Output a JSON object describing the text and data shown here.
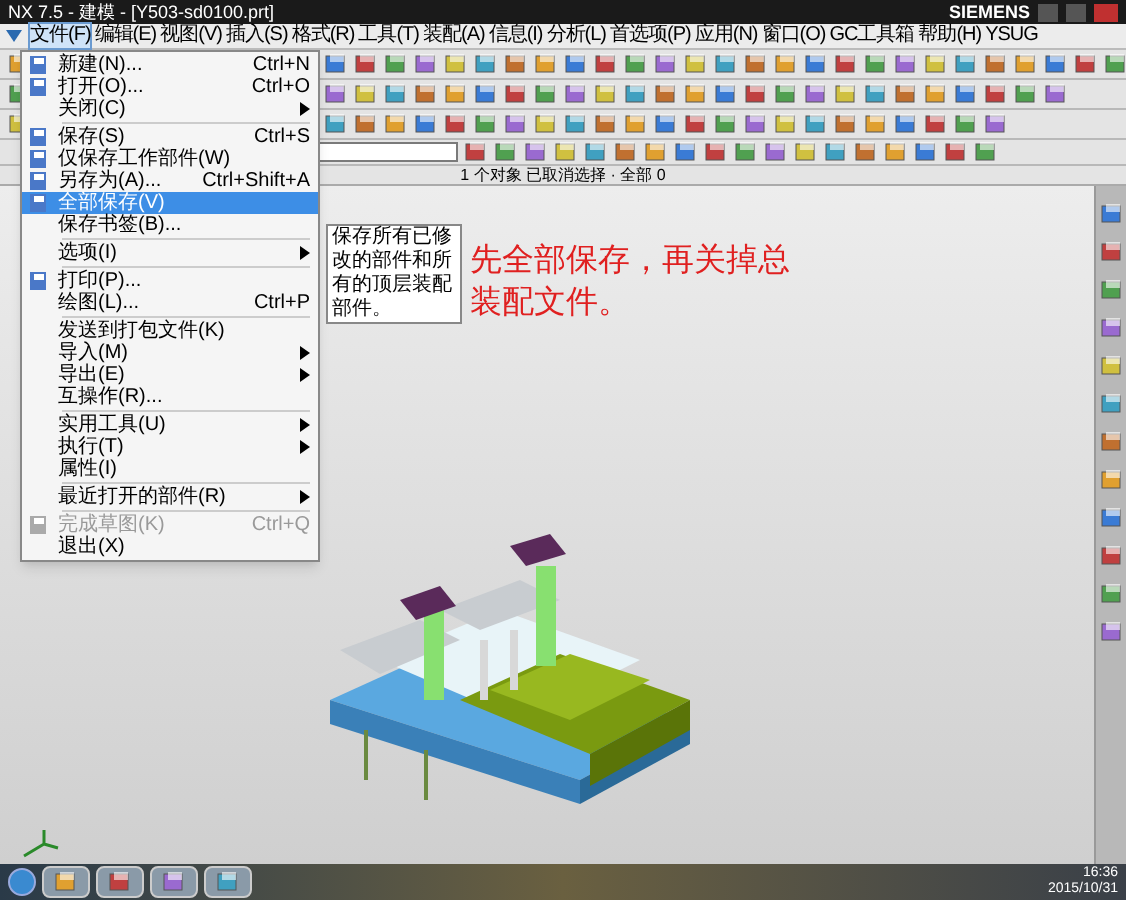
{
  "window": {
    "title": "NX 7.5 - 建模 - [Y503-sd0100.prt]",
    "brand": "SIEMENS"
  },
  "menubar": [
    {
      "label": "文件(F)",
      "selected": true
    },
    {
      "label": "编辑(E)",
      "selected": false
    },
    {
      "label": "视图(V)",
      "selected": false
    },
    {
      "label": "插入(S)",
      "selected": false
    },
    {
      "label": "格式(R)",
      "selected": false
    },
    {
      "label": "工具(T)",
      "selected": false
    },
    {
      "label": "装配(A)",
      "selected": false
    },
    {
      "label": "信息(I)",
      "selected": false
    },
    {
      "label": "分析(L)",
      "selected": false
    },
    {
      "label": "首选项(P)",
      "selected": false
    },
    {
      "label": "应用(N)",
      "selected": false
    },
    {
      "label": "窗口(O)",
      "selected": false
    },
    {
      "label": "GC工具箱",
      "selected": false
    },
    {
      "label": "帮助(H)",
      "selected": false
    },
    {
      "label": "YSUG",
      "selected": false
    }
  ],
  "status_line": "1 个对象 已取消选择 · 全部 0",
  "file_menu": [
    {
      "kind": "item",
      "label": "新建(N)...",
      "shortcut": "Ctrl+N",
      "has_icon": true,
      "submenu": false,
      "selected": false,
      "disabled": false
    },
    {
      "kind": "item",
      "label": "打开(O)...",
      "shortcut": "Ctrl+O",
      "has_icon": true,
      "submenu": false,
      "selected": false,
      "disabled": false
    },
    {
      "kind": "item",
      "label": "关闭(C)",
      "has_icon": false,
      "submenu": true,
      "selected": false,
      "disabled": false
    },
    {
      "kind": "separator"
    },
    {
      "kind": "item",
      "label": "保存(S)",
      "shortcut": "Ctrl+S",
      "has_icon": true,
      "submenu": false,
      "selected": false,
      "disabled": false
    },
    {
      "kind": "item",
      "label": "仅保存工作部件(W)",
      "has_icon": true,
      "submenu": false,
      "selected": false,
      "disabled": false
    },
    {
      "kind": "item",
      "label": "另存为(A)...",
      "shortcut": "Ctrl+Shift+A",
      "has_icon": true,
      "submenu": false,
      "selected": false,
      "disabled": false
    },
    {
      "kind": "item",
      "label": "全部保存(V)",
      "has_icon": true,
      "submenu": false,
      "selected": true,
      "disabled": false
    },
    {
      "kind": "item",
      "label": "保存书签(B)...",
      "has_icon": false,
      "submenu": false,
      "selected": false,
      "disabled": false
    },
    {
      "kind": "separator"
    },
    {
      "kind": "item",
      "label": "选项(I)",
      "has_icon": false,
      "submenu": true,
      "selected": false,
      "disabled": false
    },
    {
      "kind": "separator"
    },
    {
      "kind": "item",
      "label": "打印(P)...",
      "has_icon": true,
      "submenu": false,
      "selected": false,
      "disabled": false
    },
    {
      "kind": "item",
      "label": "绘图(L)...",
      "shortcut": "Ctrl+P",
      "has_icon": false,
      "submenu": false,
      "selected": false,
      "disabled": false
    },
    {
      "kind": "separator"
    },
    {
      "kind": "item",
      "label": "发送到打包文件(K)",
      "has_icon": false,
      "submenu": false,
      "selected": false,
      "disabled": false
    },
    {
      "kind": "item",
      "label": "导入(M)",
      "has_icon": false,
      "submenu": true,
      "selected": false,
      "disabled": false
    },
    {
      "kind": "item",
      "label": "导出(E)",
      "has_icon": false,
      "submenu": true,
      "selected": false,
      "disabled": false
    },
    {
      "kind": "item",
      "label": "互操作(R)...",
      "has_icon": false,
      "submenu": false,
      "selected": false,
      "disabled": false
    },
    {
      "kind": "separator"
    },
    {
      "kind": "item",
      "label": "实用工具(U)",
      "has_icon": false,
      "submenu": true,
      "selected": false,
      "disabled": false
    },
    {
      "kind": "item",
      "label": "执行(T)",
      "has_icon": false,
      "submenu": true,
      "selected": false,
      "disabled": false
    },
    {
      "kind": "item",
      "label": "属性(I)",
      "has_icon": false,
      "submenu": false,
      "selected": false,
      "disabled": false
    },
    {
      "kind": "separator"
    },
    {
      "kind": "item",
      "label": "最近打开的部件(R)",
      "has_icon": false,
      "submenu": true,
      "selected": false,
      "disabled": false
    },
    {
      "kind": "separator"
    },
    {
      "kind": "item",
      "label": "完成草图(K)",
      "shortcut": "Ctrl+Q",
      "has_icon": true,
      "submenu": false,
      "selected": false,
      "disabled": true
    },
    {
      "kind": "item",
      "label": "退出(X)",
      "has_icon": false,
      "submenu": false,
      "selected": false,
      "disabled": false
    }
  ],
  "tooltip": "保存所有已修改的部件和所有的顶层装配部件。",
  "annotation": "先全部保存，再关掉总装配文件。",
  "taskbar": {
    "time": "16:36",
    "date": "2015/10/31"
  }
}
